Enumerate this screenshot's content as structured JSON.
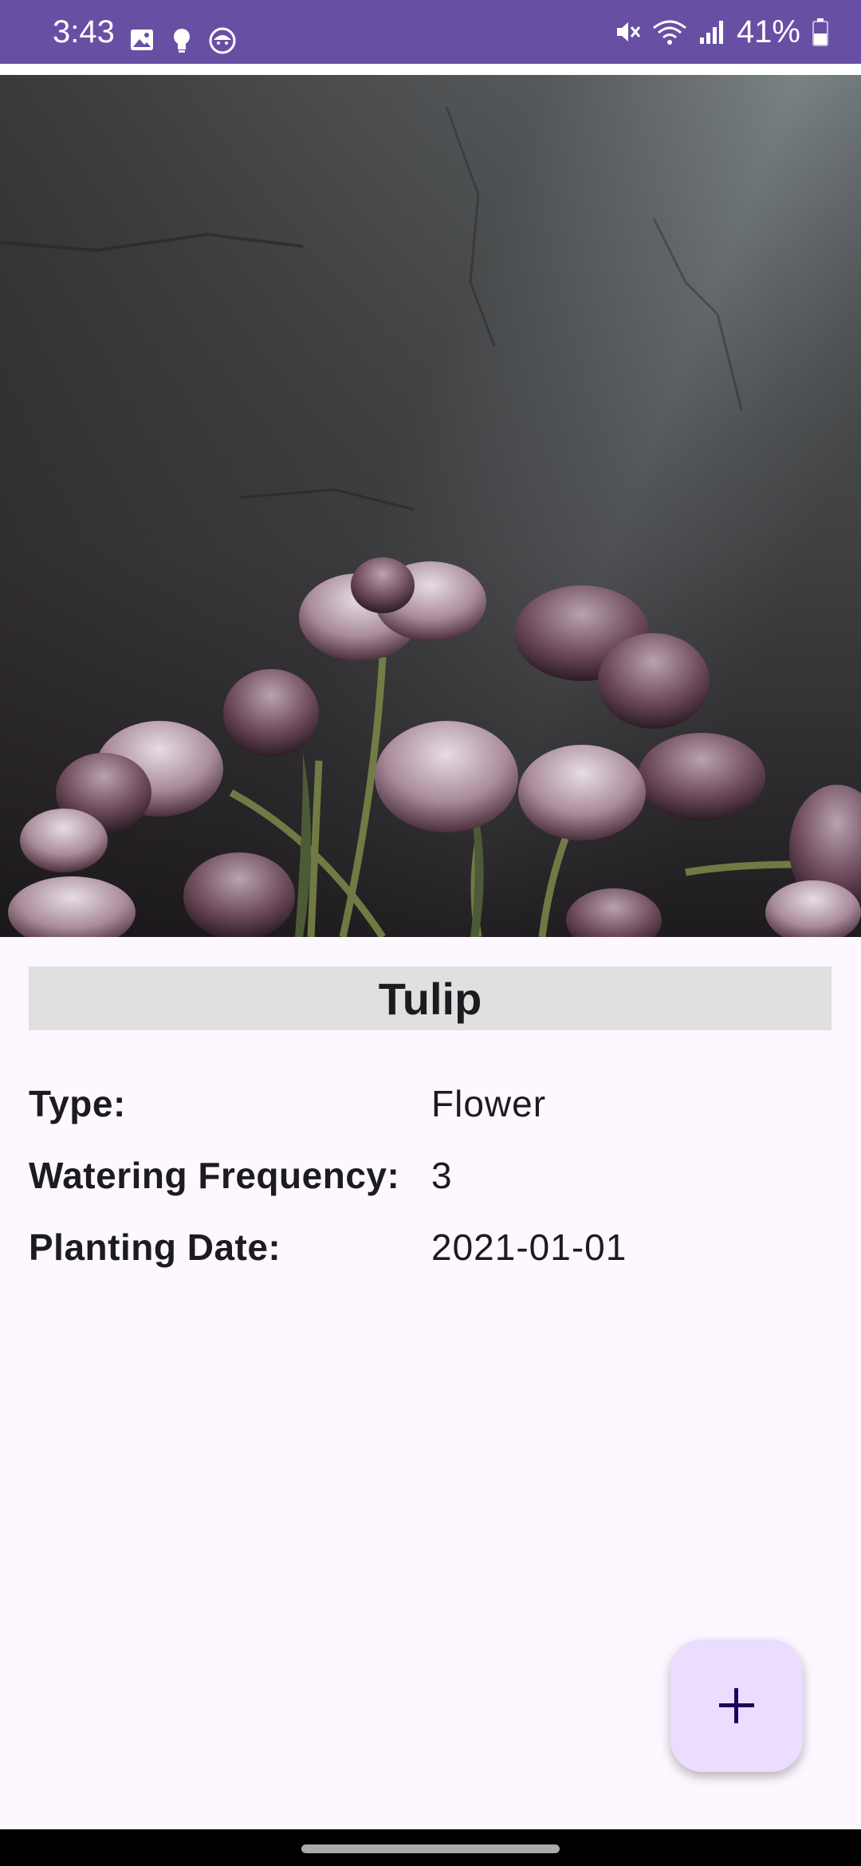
{
  "status_bar": {
    "time": "3:43",
    "battery_percent": "41%",
    "left_icons": [
      "image-icon",
      "bulb-icon",
      "face-icon"
    ],
    "right_icons": [
      "mute-icon",
      "wifi-icon",
      "signal-icon",
      "battery-icon"
    ],
    "color": "#6750A4"
  },
  "plant": {
    "name": "Tulip",
    "image_icon": "tulip-photo",
    "details": [
      {
        "label": "Type:",
        "value": "Flower"
      },
      {
        "label": "Watering Frequency:",
        "value": "3"
      },
      {
        "label": "Planting Date:",
        "value": "2021-01-01"
      }
    ]
  },
  "fab": {
    "icon": "plus-icon",
    "color": "#EADDFF"
  }
}
